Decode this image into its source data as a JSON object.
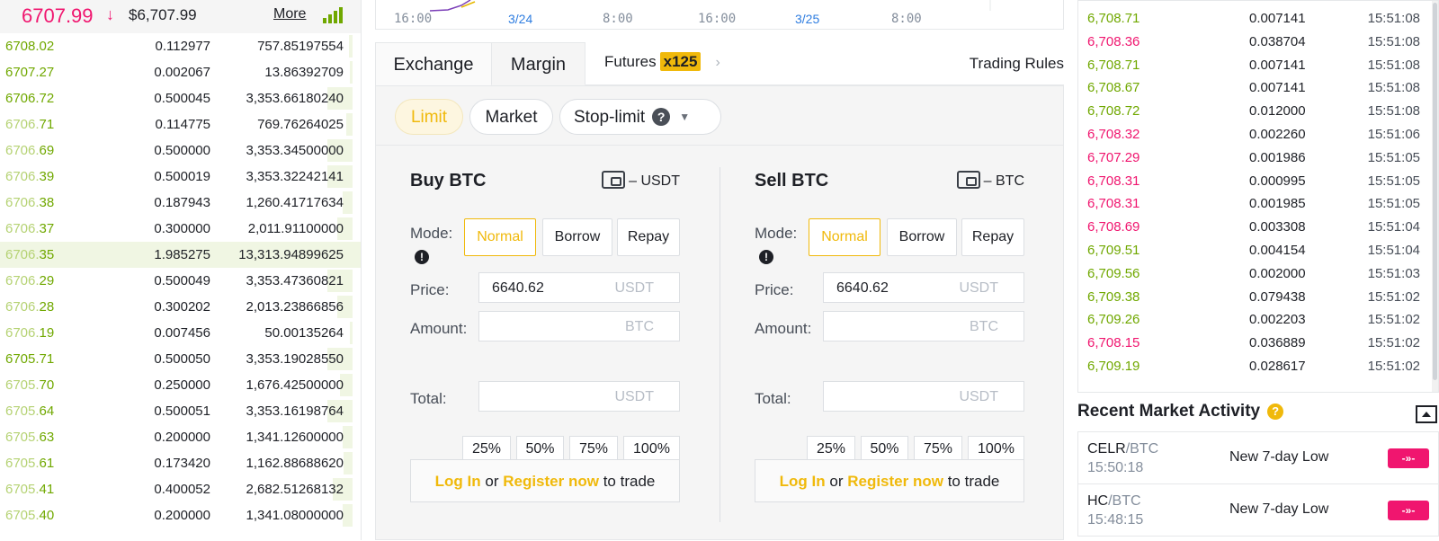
{
  "orderbook": {
    "last_price": "6707.99",
    "arrow": "↓",
    "usd_price": "$6,707.99",
    "more_label": "More",
    "rows": [
      {
        "p_main": "6708.02",
        "p_dim": "",
        "amount": "0.112977",
        "total": "757.85197554",
        "depth": 0.03
      },
      {
        "p_main": "6707.27",
        "p_dim": "",
        "amount": "0.002067",
        "total": "13.86392709",
        "depth": 0.02
      },
      {
        "p_main": "6706.72",
        "p_dim": "",
        "amount": "0.500045",
        "total": "3,353.66180240",
        "depth": 0.2
      },
      {
        "p_main": "71",
        "p_dim": "6706.",
        "amount": "0.114775",
        "total": "769.76264025",
        "depth": 0.05
      },
      {
        "p_main": "69",
        "p_dim": "6706.",
        "amount": "0.500000",
        "total": "3,353.34500000",
        "depth": 0.2
      },
      {
        "p_main": "39",
        "p_dim": "6706.",
        "amount": "0.500019",
        "total": "3,353.32242141",
        "depth": 0.2
      },
      {
        "p_main": "38",
        "p_dim": "6706.",
        "amount": "0.187943",
        "total": "1,260.41717634",
        "depth": 0.08
      },
      {
        "p_main": "37",
        "p_dim": "6706.",
        "amount": "0.300000",
        "total": "2,011.91100000",
        "depth": 0.12
      },
      {
        "p_main": "35",
        "p_dim": "6706.",
        "amount": "1.985275",
        "total": "13,313.94899625",
        "depth": 1.0
      },
      {
        "p_main": "29",
        "p_dim": "6706.",
        "amount": "0.500049",
        "total": "3,353.47360821",
        "depth": 0.2
      },
      {
        "p_main": "28",
        "p_dim": "6706.",
        "amount": "0.300202",
        "total": "2,013.23866856",
        "depth": 0.12
      },
      {
        "p_main": "19",
        "p_dim": "6706.",
        "amount": "0.007456",
        "total": "50.00135264",
        "depth": 0.02
      },
      {
        "p_main": "6705.71",
        "p_dim": "",
        "amount": "0.500050",
        "total": "3,353.19028550",
        "depth": 0.2
      },
      {
        "p_main": "70",
        "p_dim": "6705.",
        "amount": "0.250000",
        "total": "1,676.42500000",
        "depth": 0.1
      },
      {
        "p_main": "64",
        "p_dim": "6705.",
        "amount": "0.500051",
        "total": "3,353.16198764",
        "depth": 0.2
      },
      {
        "p_main": "63",
        "p_dim": "6705.",
        "amount": "0.200000",
        "total": "1,341.12600000",
        "depth": 0.08
      },
      {
        "p_main": "61",
        "p_dim": "6705.",
        "amount": "0.173420",
        "total": "1,162.88688620",
        "depth": 0.07
      },
      {
        "p_main": "41",
        "p_dim": "6705.",
        "amount": "0.400052",
        "total": "2,682.51268132",
        "depth": 0.16
      },
      {
        "p_main": "40",
        "p_dim": "6705.",
        "amount": "0.200000",
        "total": "1,341.08000000",
        "depth": 0.08
      }
    ],
    "highlight_row": 8
  },
  "chart_axis": {
    "ticks": [
      "16:00",
      "3/24",
      "8:00",
      "16:00",
      "3/25",
      "8:00"
    ]
  },
  "tabs": {
    "exchange": "Exchange",
    "margin": "Margin",
    "futures": "Futures",
    "futures_badge": "x125",
    "futures_chevron": "›",
    "trading_rules": "Trading Rules"
  },
  "order_types": {
    "limit": "Limit",
    "market": "Market",
    "stop_limit": "Stop-limit",
    "help_glyph": "?",
    "dropdown_glyph": "▼"
  },
  "buy": {
    "title": "Buy BTC",
    "balance": "– USDT",
    "mode_label": "Mode:",
    "modes": [
      "Normal",
      "Borrow",
      "Repay"
    ],
    "price_label": "Price:",
    "price_value": "6640.62",
    "price_unit": "USDT",
    "amount_label": "Amount:",
    "amount_unit": "BTC",
    "pcts": [
      "25%",
      "50%",
      "75%",
      "100%"
    ],
    "total_label": "Total:",
    "total_unit": "USDT",
    "login": "Log In",
    "or": "or",
    "register": "Register now",
    "to_trade": "to trade"
  },
  "sell": {
    "title": "Sell BTC",
    "balance": "– BTC",
    "mode_label": "Mode:",
    "modes": [
      "Normal",
      "Borrow",
      "Repay"
    ],
    "price_label": "Price:",
    "price_value": "6640.62",
    "price_unit": "USDT",
    "amount_label": "Amount:",
    "amount_unit": "BTC",
    "pcts": [
      "25%",
      "50%",
      "75%",
      "100%"
    ],
    "total_label": "Total:",
    "total_unit": "USDT",
    "login": "Log In",
    "or": "or",
    "register": "Register now",
    "to_trade": "to trade"
  },
  "trades": [
    {
      "price": "6,708.71",
      "dir": "up",
      "amount": "0.007141",
      "time": "15:51:08"
    },
    {
      "price": "6,708.36",
      "dir": "down",
      "amount": "0.038704",
      "time": "15:51:08"
    },
    {
      "price": "6,708.71",
      "dir": "up",
      "amount": "0.007141",
      "time": "15:51:08"
    },
    {
      "price": "6,708.67",
      "dir": "up",
      "amount": "0.007141",
      "time": "15:51:08"
    },
    {
      "price": "6,708.72",
      "dir": "up",
      "amount": "0.012000",
      "time": "15:51:08"
    },
    {
      "price": "6,708.32",
      "dir": "down",
      "amount": "0.002260",
      "time": "15:51:06"
    },
    {
      "price": "6,707.29",
      "dir": "down",
      "amount": "0.001986",
      "time": "15:51:05"
    },
    {
      "price": "6,708.31",
      "dir": "down",
      "amount": "0.000995",
      "time": "15:51:05"
    },
    {
      "price": "6,708.31",
      "dir": "down",
      "amount": "0.001985",
      "time": "15:51:05"
    },
    {
      "price": "6,708.69",
      "dir": "down",
      "amount": "0.003308",
      "time": "15:51:04"
    },
    {
      "price": "6,709.51",
      "dir": "up",
      "amount": "0.004154",
      "time": "15:51:04"
    },
    {
      "price": "6,709.56",
      "dir": "up",
      "amount": "0.002000",
      "time": "15:51:03"
    },
    {
      "price": "6,709.38",
      "dir": "up",
      "amount": "0.079438",
      "time": "15:51:02"
    },
    {
      "price": "6,709.26",
      "dir": "up",
      "amount": "0.002203",
      "time": "15:51:02"
    },
    {
      "price": "6,708.15",
      "dir": "down",
      "amount": "0.036889",
      "time": "15:51:02"
    },
    {
      "price": "6,709.19",
      "dir": "up",
      "amount": "0.028617",
      "time": "15:51:02"
    }
  ],
  "recent_activity": {
    "title": "Recent Market Activity",
    "help_glyph": "?",
    "items": [
      {
        "base": "CELR",
        "quote": "/BTC",
        "time": "15:50:18",
        "event": "New 7-day Low",
        "badge": "-»-"
      },
      {
        "base": "HC",
        "quote": "/BTC",
        "time": "15:48:15",
        "event": "New 7-day Low",
        "badge": "-»-"
      }
    ]
  },
  "colors": {
    "up": "#70a800",
    "down": "#f0166f",
    "accent": "#f0b90b"
  }
}
